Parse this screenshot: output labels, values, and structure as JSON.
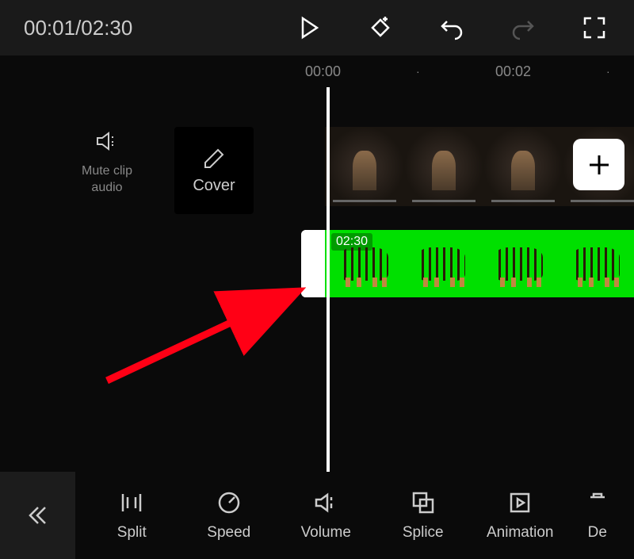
{
  "timecode": {
    "current": "00:01",
    "total": "02:30",
    "display": "00:01/02:30"
  },
  "ruler": {
    "t0": "00:00",
    "t2": "00:02"
  },
  "left_controls": {
    "mute_label": "Mute clip audio",
    "cover_label": "Cover"
  },
  "clip": {
    "duration_label": "02:30"
  },
  "toolbar": {
    "split": "Split",
    "speed": "Speed",
    "volume": "Volume",
    "splice": "Splice",
    "animation": "Animation",
    "delete_partial": "De"
  }
}
